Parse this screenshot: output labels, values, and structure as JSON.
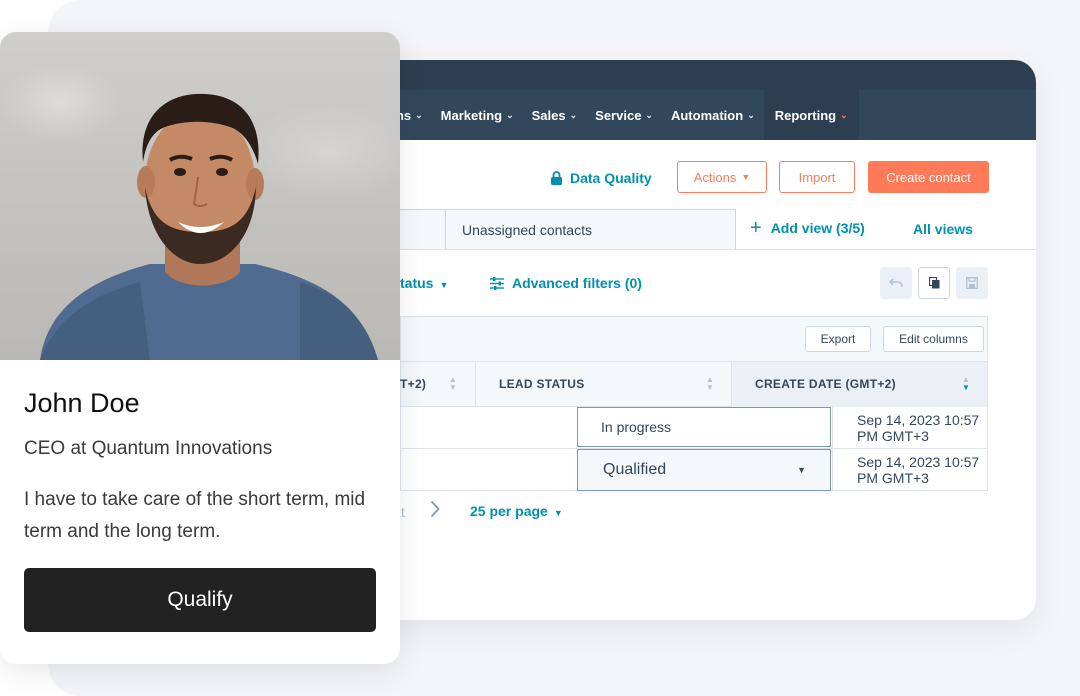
{
  "nav": {
    "items": [
      {
        "label": "ons",
        "active": false
      },
      {
        "label": "Marketing",
        "active": false
      },
      {
        "label": "Sales",
        "active": false
      },
      {
        "label": "Service",
        "active": false
      },
      {
        "label": "Automation",
        "active": false
      },
      {
        "label": "Reporting",
        "active": true
      }
    ],
    "chevron": "⌄"
  },
  "header": {
    "data_quality": "Data Quality",
    "actions": "Actions",
    "import": "Import",
    "create_contact": "Create contact"
  },
  "views": {
    "unassigned": "Unassigned contacts",
    "add_view": "Add view (3/5)",
    "all_views": "All views"
  },
  "filters": {
    "status": "tatus",
    "advanced": "Advanced filters (0)"
  },
  "table_toolbar": {
    "export": "Export",
    "edit_columns": "Edit columns"
  },
  "table": {
    "columns": {
      "partial": "T+2)",
      "lead_status": "LEAD STATUS",
      "create_date": "CREATE DATE (GMT+2)"
    },
    "rows": [
      {
        "lead_status": "In progress",
        "create_date": "Sep 14, 2023 10:57 PM GMT+3"
      },
      {
        "lead_status": "Qualified",
        "create_date": "Sep 14, 2023 10:57 PM GMT+3"
      }
    ]
  },
  "pager": {
    "next": "xt",
    "per_page": "25 per page"
  },
  "card": {
    "name": "John Doe",
    "role": "CEO at Quantum Innovations",
    "quote": "I have to take care of the short term, mid term and the long term.",
    "button": "Qualify"
  },
  "colors": {
    "nav_bg": "#33475b",
    "accent": "#ff7a59",
    "link": "#0091ae",
    "text": "#33475b"
  },
  "icons": {
    "lock": "lock-icon",
    "filter": "sliders-icon",
    "undo": "undo-icon",
    "clone": "copy-icon",
    "save": "save-icon"
  }
}
